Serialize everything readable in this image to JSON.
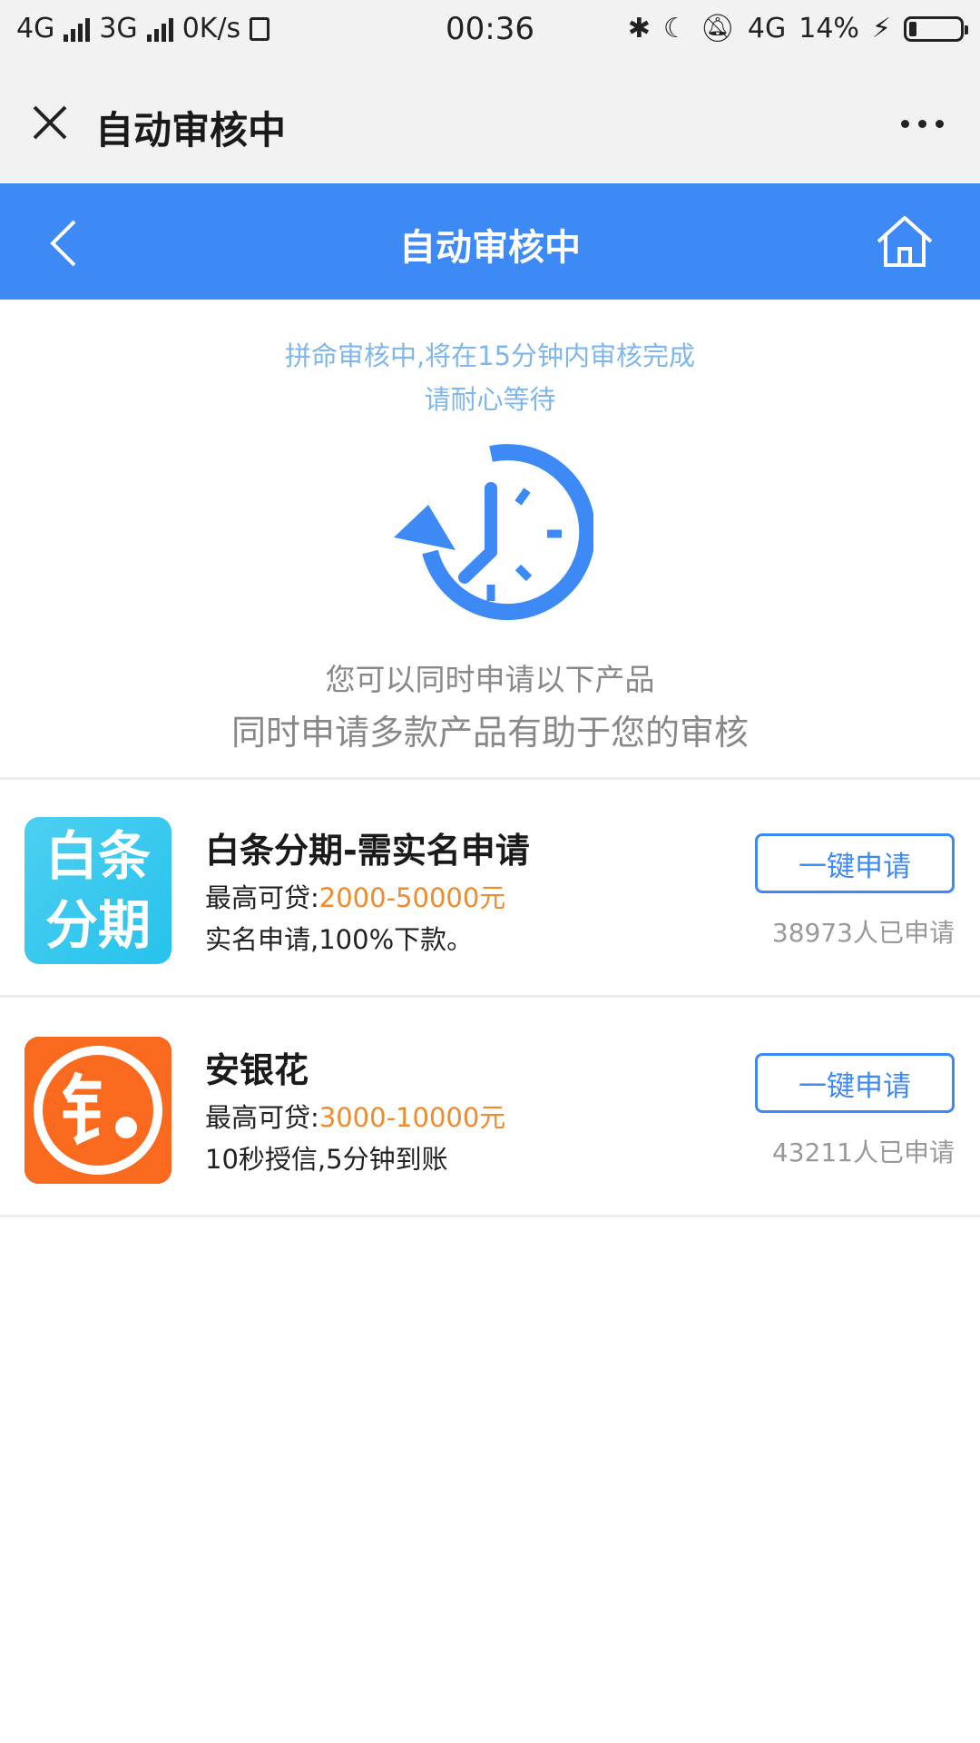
{
  "status_bar": {
    "network1": "4G",
    "network2": "3G",
    "speed": "0K/s",
    "time": "00:36",
    "network3": "4G",
    "battery": "14%",
    "battery_level": 0.14
  },
  "wechat_bar": {
    "title": "自动审核中"
  },
  "header": {
    "title": "自动审核中"
  },
  "review": {
    "notice_line1": "拼命审核中,将在15分钟内审核完成",
    "notice_line2": "请耐心等待",
    "tip_line1": "您可以同时申请以下产品",
    "tip_line2": "同时申请多款产品有助于您的审核"
  },
  "products": [
    {
      "name": "白条分期-需实名申请",
      "amount_label": "最高可贷:",
      "amount_value": "2000-50000元",
      "desc": "实名申请,100%下款。",
      "apply_label": "一键申请",
      "applied_count": "38973人已申请",
      "logo_text": [
        "白条",
        "分期"
      ]
    },
    {
      "name": "安银花",
      "amount_label": "最高可贷:",
      "amount_value": "3000-10000元",
      "desc": "10秒授信,5分钟到账",
      "apply_label": "一键申请",
      "applied_count": "43211人已申请",
      "logo_text": [
        "钅"
      ]
    }
  ],
  "colors": {
    "header_blue": "#3d8af7",
    "notice_blue": "#7fb6ec",
    "amount_orange": "#f08a2c",
    "logo_cyan": "#33c6ee",
    "logo_orange": "#f96a1e"
  },
  "icons": {
    "close": "close-icon",
    "more": "more-icon",
    "back": "back-arrow-icon",
    "home": "home-icon",
    "clock": "clock-refresh-icon"
  }
}
